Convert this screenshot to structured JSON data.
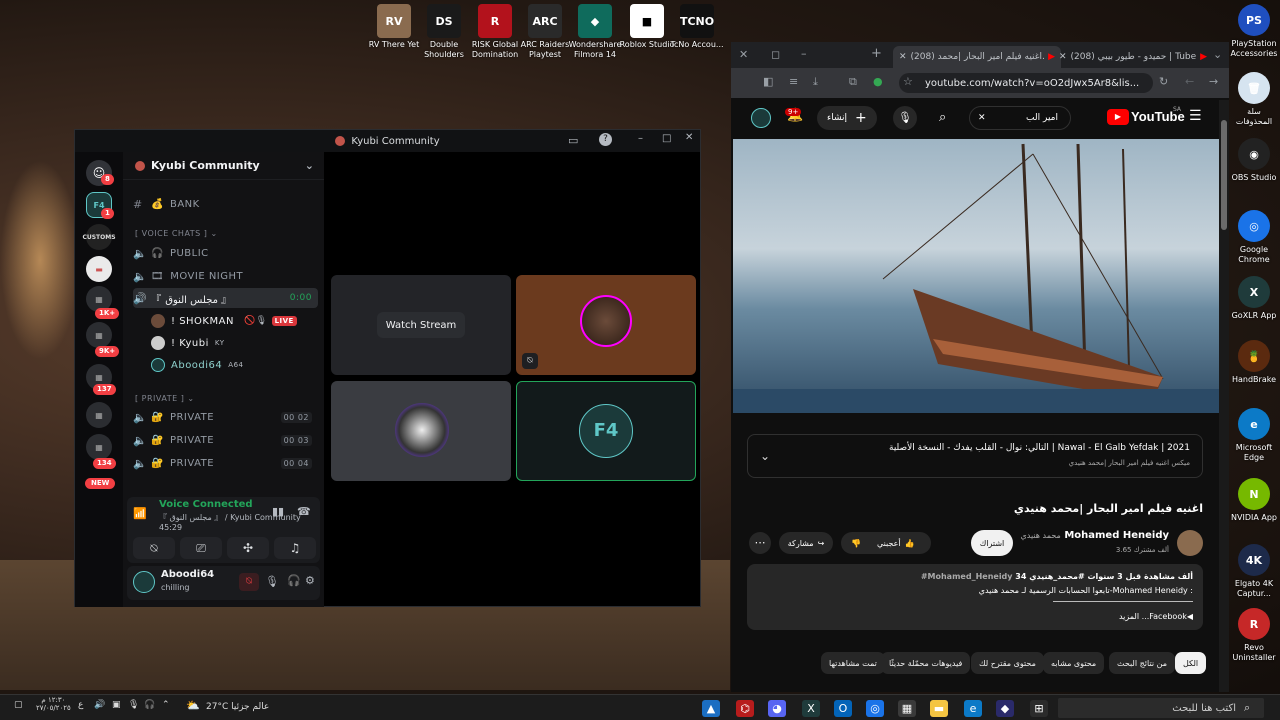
{
  "desktop": {
    "top_icons": [
      {
        "label": "RV There Yet",
        "glyph": "RV",
        "color": "#8a6b4f"
      },
      {
        "label": "Double Shoulders",
        "glyph": "DS",
        "color": "#1a1a1a"
      },
      {
        "label": "RISK Global Domination",
        "glyph": "R",
        "color": "#b3121c"
      },
      {
        "label": "ARC Raiders Playtest",
        "glyph": "ARC",
        "color": "#2a2a2a"
      },
      {
        "label": "Wondershare Filmora 14",
        "glyph": "◆",
        "color": "#0f6b5c"
      },
      {
        "label": "Roblox Studio",
        "glyph": "■",
        "color": "#ffffff"
      },
      {
        "label": "TcNo Accou...",
        "glyph": "TCNO",
        "color": "#111111"
      }
    ],
    "right_icons": [
      {
        "label": "PlayStation Accessories",
        "glyph": "PS",
        "color": "#1f4fbf"
      },
      {
        "label": "سلة المحذوفات",
        "glyph": "🗑",
        "color": "#d6e4f0"
      },
      {
        "label": "OBS Studio",
        "glyph": "◉",
        "color": "#222222"
      },
      {
        "label": "Google Chrome",
        "glyph": "◎",
        "color": "#1a73e8"
      },
      {
        "label": "GoXLR App",
        "glyph": "X",
        "color": "#1f3b3b"
      },
      {
        "label": "HandBrake",
        "glyph": "🍍",
        "color": "#5b2a0f"
      },
      {
        "label": "Microsoft Edge",
        "glyph": "e",
        "color": "#0c7ac7"
      },
      {
        "label": "NVIDIA App",
        "glyph": "N",
        "color": "#76b900"
      },
      {
        "label": "Elgato 4K Captur...",
        "glyph": "4K",
        "color": "#1d2a4a"
      },
      {
        "label": "Revo Uninstaller",
        "glyph": "R",
        "color": "#c62828"
      }
    ]
  },
  "discord": {
    "window_title": "Kyubi Community",
    "server_name": "Kyubi Community",
    "rail_badges": [
      "8",
      "1",
      "1K+",
      "9K+",
      "137",
      "134"
    ],
    "new_label": "NEW",
    "channels": {
      "bank": "BANK",
      "voice_category": "[ VOICE CHATS ]",
      "public": "PUBLIC",
      "movie_night": "MOVIE NIGHT",
      "majlis": "『 مجلس النوق 』",
      "majlis_time": "0:00",
      "private_category": "[ PRIVATE ]",
      "private_1": "PRIVATE",
      "private_2": "PRIVATE",
      "private_3": "PRIVATE",
      "p1_count": "00 02",
      "p2_count": "00 03",
      "p3_count": "00 04"
    },
    "voice_users": [
      {
        "name": "! SHOKMAN",
        "tag": "",
        "badge": "LIVE"
      },
      {
        "name": "! Kyubi",
        "tag": "KY",
        "badge": ""
      },
      {
        "name": "Aboodi64",
        "tag": "A64",
        "badge": ""
      }
    ],
    "watch_stream": "Watch Stream",
    "voice_connected": "Voice Connected",
    "voice_channel_path": "『 مجلس النوق 』 / Kyubi Community",
    "voice_duration": "45:29",
    "user": {
      "name": "Aboodi64",
      "status": "chilling"
    }
  },
  "chrome": {
    "tab1": "(208) اغنيه فيلم امير البحار |محمد...",
    "tab2": "(208) حميدو - طيور بيبي | Tube...",
    "url": "youtube.com/watch?v=oO2dJwx5Ar8&lis...",
    "yt_logo": "YouTube",
    "yt_region": "SA",
    "search_value": "امير الب",
    "create_label": "إنشاء",
    "notif_badge": "9+",
    "next_up_title": "التالي: نوال - القلب يفدك - النسخة الأصلية | Nawal - El Galb Yefdak | 2021",
    "next_up_sub": "ميكس اغنيه فيلم امير البحار |محمد هنيدي",
    "video_title": "اغنيه فيلم امير البحار |محمد هنيدي",
    "channel_name": "Mohamed Heneidy",
    "channel_alias": "محمد هنيدي",
    "subscribers": "3.65 ألف مشترك",
    "subscribe": "اشتراك",
    "like": "أعجبني",
    "share": "مشاركة",
    "desc_stats": "34 ألف مشاهدة قبل 3 سنوات #محمد_هنيدي",
    "desc_hashtag": "#Mohamed_Heneidy",
    "desc_line2": "تابعوا الحسابات الرسمية لـ محمد هنيدي-Mohamed Heneidy :",
    "desc_more": "المزيد ...Facebook◀",
    "chips": [
      "الكل",
      "من نتائج البحث",
      "محتوى مشابه",
      "محتوى مقترح لك",
      "فيديوهات محمّلة حديثًا",
      "تمت مشاهدتها"
    ]
  },
  "taskbar": {
    "search_placeholder": "اكتب هنا للبحث",
    "weather": "27°C عالم جزئيا",
    "time": "١٢:٣٠ م",
    "date": "٢٧/٠٥/٢٠٢٥",
    "lang": "ع"
  },
  "colors": {
    "discord_green": "#23a55a",
    "discord_red": "#f23f43",
    "yt_red": "#ff0000",
    "accent_blue": "#3ea6ff"
  }
}
